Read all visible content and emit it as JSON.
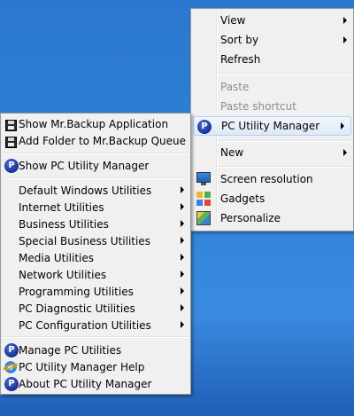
{
  "desktop_menu": {
    "items": [
      {
        "label": "View",
        "arrow": true
      },
      {
        "label": "Sort by",
        "arrow": true
      },
      {
        "label": "Refresh"
      },
      {
        "label": "Paste",
        "disabled": true
      },
      {
        "label": "Paste shortcut",
        "disabled": true
      },
      {
        "label": "PC Utility Manager",
        "arrow": true,
        "icon": "pc-utility-manager-icon"
      },
      {
        "label": "New",
        "arrow": true
      },
      {
        "label": "Screen resolution",
        "icon": "monitor-icon"
      },
      {
        "label": "Gadgets",
        "icon": "gadgets-icon"
      },
      {
        "label": "Personalize",
        "icon": "personalize-icon"
      }
    ]
  },
  "pcu_menu": {
    "top": [
      {
        "label": "Show Mr.Backup Application",
        "icon": "floppy-disk-icon"
      },
      {
        "label": "Add Folder to Mr.Backup Queue",
        "icon": "floppy-disk-icon"
      },
      {
        "label": "Show PC Utility Manager",
        "icon": "pc-utility-manager-icon"
      }
    ],
    "submenus": [
      "Default Windows Utilities",
      "Internet Utilities",
      "Business Utilities",
      "Special Business Utilities",
      "Media Utilities",
      "Network Utilities",
      "Programming Utilities",
      "PC Diagnostic Utilities",
      "PC Configuration Utilities"
    ],
    "bottom": [
      {
        "label": "Manage PC Utilities",
        "icon": "pc-utility-manager-icon"
      },
      {
        "label": "PC Utility Manager Help",
        "icon": "internet-explorer-icon"
      },
      {
        "label": "About PC Utility Manager",
        "icon": "pc-utility-manager-icon"
      }
    ]
  },
  "icon_glyph": {
    "pcu": "P"
  }
}
